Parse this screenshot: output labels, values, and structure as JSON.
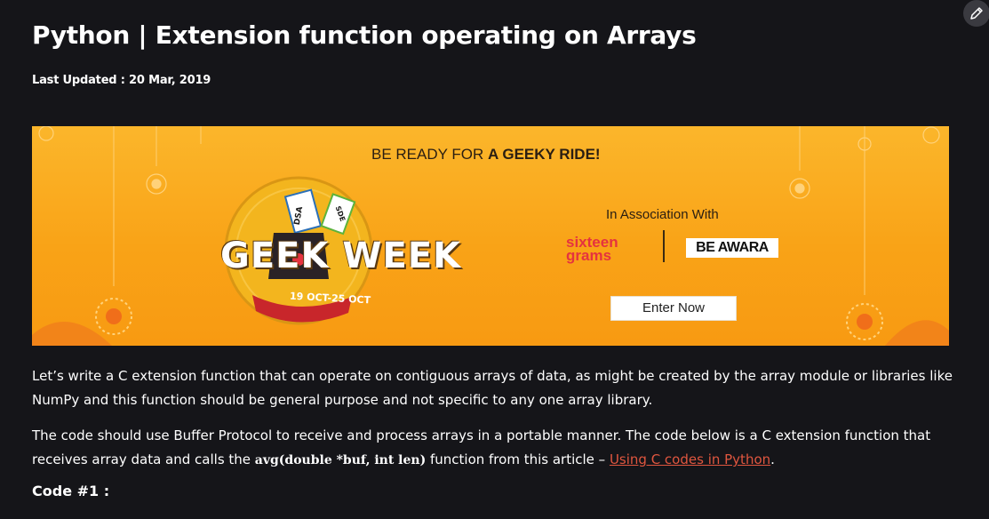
{
  "article": {
    "title": "Python | Extension function operating on Arrays",
    "last_updated": "Last Updated : 20 Mar, 2019"
  },
  "banner": {
    "heading_pre": "BE READY FOR ",
    "heading_bold": "A GEEKY RIDE!",
    "logo_text": "GEEK WEEK",
    "dates": "19 OCT-25 OCT",
    "tags": [
      "DSA",
      "SDE"
    ],
    "association": "In Association With",
    "sponsor1_line1": "sixteen",
    "sponsor1_line2": "grams",
    "sponsor2": "BE AWARA",
    "cta": "Enter Now",
    "colors": {
      "background": "#f9a317",
      "medal": "#f3b51e",
      "ribbon": "#c8262b"
    }
  },
  "body": {
    "p1": "Let’s write a C extension function that can operate on contiguous arrays of data, as might be created by the array module or libraries like NumPy and this function should be general purpose and not specific to any one array library.",
    "p2_text": "The code should use Buffer Protocol to receive and process arrays in a portable manner. The code below is a C extension function that receives array data and calls the ",
    "p2_code": "avg(double *buf, int len)",
    "p2_after": " function from this article – ",
    "p2_link": "Using C codes in Python",
    "p2_end": ".",
    "code_label": "Code #1 :"
  },
  "icons": {
    "edit": "pencil-icon"
  }
}
